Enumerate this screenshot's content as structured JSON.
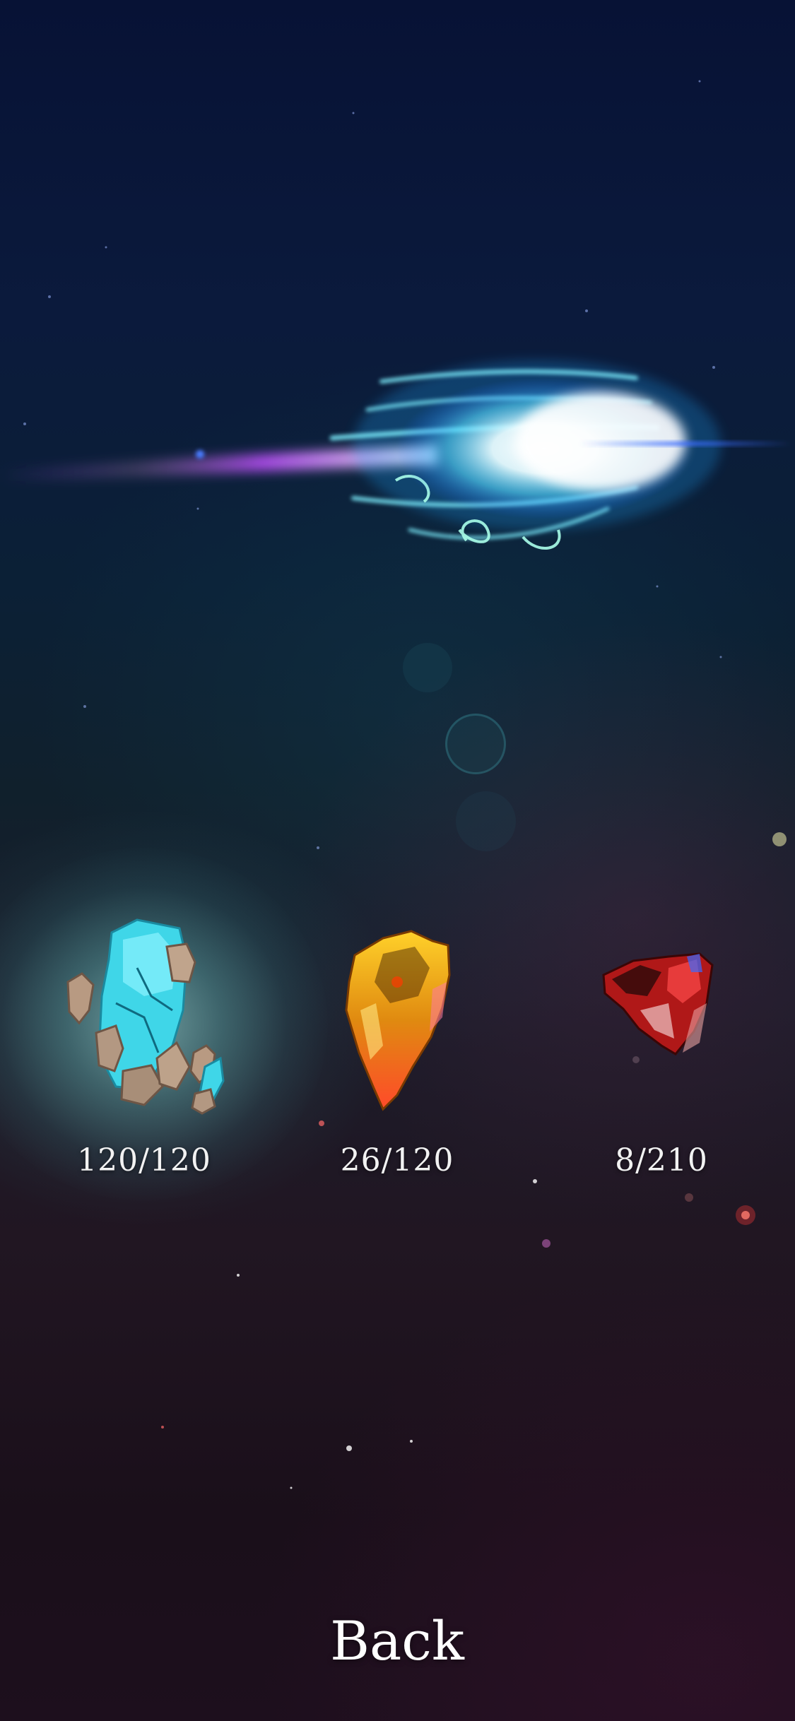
{
  "crystals": [
    {
      "name": "cyan-stone-crystal",
      "count": "120/120",
      "selected": true
    },
    {
      "name": "amber-crystal",
      "count": "26/120",
      "selected": false
    },
    {
      "name": "red-crystal",
      "count": "8/210",
      "selected": false
    }
  ],
  "back_label": "Back",
  "colors": {
    "comet_core": "#ffffff",
    "comet_glow": "#56d8ff",
    "comet_trail": "#b04cff",
    "selected_glow": "#aaebe6"
  }
}
